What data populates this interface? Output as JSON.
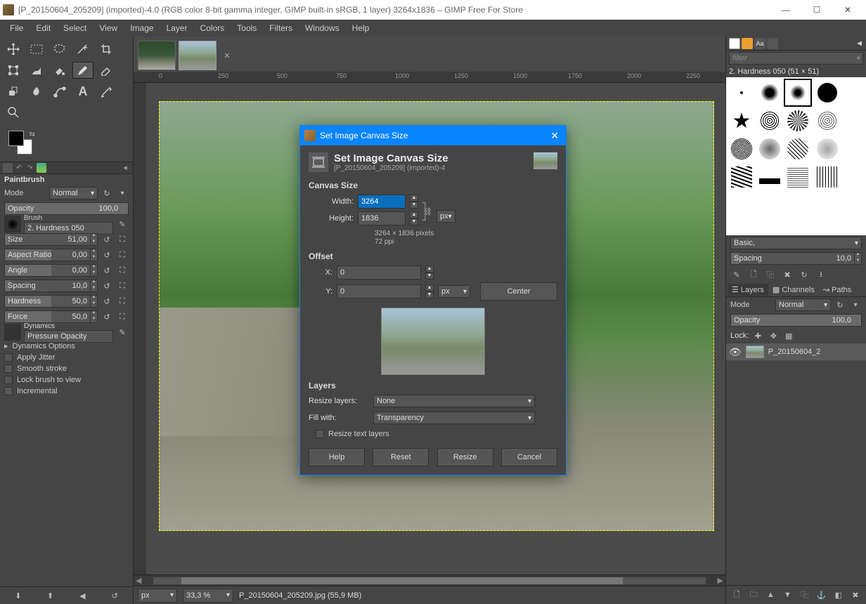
{
  "titlebar": {
    "title": "[P_20150604_205209] (imported)-4.0 (RGB color 8-bit gamma integer, GIMP built-in sRGB, 1 layer) 3264x1836 – GIMP Free For Store"
  },
  "menu": {
    "items": [
      "File",
      "Edit",
      "Select",
      "View",
      "Image",
      "Layer",
      "Colors",
      "Tools",
      "Filters",
      "Windows",
      "Help"
    ]
  },
  "left": {
    "tool_name": "Paintbrush",
    "mode_label": "Mode",
    "mode_value": "Normal",
    "opacity_label": "Opacity",
    "opacity_value": "100,0",
    "brush_label": "Brush",
    "brush_value": "2. Hardness 050",
    "size_label": "Size",
    "size_value": "51,00",
    "aspect_label": "Aspect Ratio",
    "aspect_value": "0,00",
    "angle_label": "Angle",
    "angle_value": "0,00",
    "spacing_label": "Spacing",
    "spacing_value": "10,0",
    "hardness_label": "Hardness",
    "hardness_value": "50,0",
    "force_label": "Force",
    "force_value": "50,0",
    "dynamics_label": "Dynamics",
    "dynamics_value": "Pressure Opacity",
    "dyn_options": "Dynamics Options",
    "jitter": "Apply Jitter",
    "smooth": "Smooth stroke",
    "lockview": "Lock brush to view",
    "incremental": "Incremental"
  },
  "ruler_ticks": [
    "0",
    "250",
    "500",
    "750",
    "1000",
    "1250",
    "1500",
    "1750",
    "2000",
    "2250"
  ],
  "status": {
    "unit": "px",
    "zoom": "33,3 %",
    "filename": "P_20150604_205209.jpg (55,9 MB)"
  },
  "right": {
    "filter_placeholder": "filter",
    "brush_name": "2. Hardness 050 (51 × 51)",
    "basic": "Basic,",
    "spacing_label": "Spacing",
    "spacing_value": "10,0",
    "layers_tab": "Layers",
    "channels_tab": "Channels",
    "paths_tab": "Paths",
    "mode_label": "Mode",
    "mode_value": "Normal",
    "opacity_label": "Opacity",
    "opacity_value": "100,0",
    "lock_label": "Lock:",
    "layer_name": "P_20150604_2"
  },
  "dialog": {
    "win_title": "Set Image Canvas Size",
    "header_title": "Set Image Canvas Size",
    "header_sub": "[P_20150604_205209] (imported)-4",
    "canvas_section": "Canvas Size",
    "width_label": "Width:",
    "width_value": "3264",
    "height_label": "Height:",
    "height_value": "1836",
    "unit_value": "px",
    "px_info": "3264 × 1836 pixels",
    "ppi_info": "72 ppi",
    "offset_section": "Offset",
    "x_label": "X:",
    "x_value": "0",
    "y_label": "Y:",
    "y_value": "0",
    "center_btn": "Center",
    "layers_section": "Layers",
    "resize_layers_label": "Resize layers:",
    "resize_layers_value": "None",
    "fill_with_label": "Fill with:",
    "fill_with_value": "Transparency",
    "resize_text_layers": "Resize text layers",
    "help": "Help",
    "reset": "Reset",
    "resize": "Resize",
    "cancel": "Cancel"
  }
}
